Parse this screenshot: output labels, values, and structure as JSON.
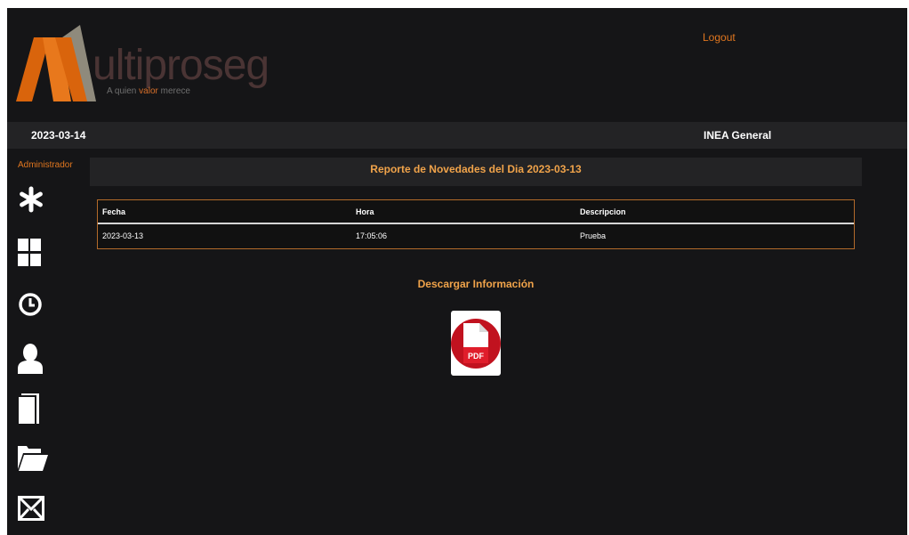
{
  "brand": {
    "logo_letter": "M",
    "name": "ultiproseg",
    "tagline_parts": [
      "A quien ",
      "valor",
      " merece"
    ],
    "colors": {
      "accent": "#e0761f",
      "orange": "#d9640c",
      "grey": "#8f8a7c"
    }
  },
  "header": {
    "logout": "Logout"
  },
  "topbar": {
    "date": "2023-03-14",
    "department": "INEA General"
  },
  "sidebar": {
    "role": "Administrador",
    "icons": [
      "asterisk-icon",
      "dashboard-grid-icon",
      "clock-icon",
      "user-icon",
      "book-icon",
      "folder-open-icon",
      "mail-icon"
    ]
  },
  "report": {
    "title": "Reporte de Novedades del Dia 2023-03-13",
    "columns": [
      "Fecha",
      "Hora",
      "Descripcion"
    ],
    "rows": [
      [
        "2023-03-13",
        "17:05:06",
        "Prueba"
      ]
    ]
  },
  "download": {
    "label": "Descargar Información",
    "pdf_label": "PDF"
  }
}
